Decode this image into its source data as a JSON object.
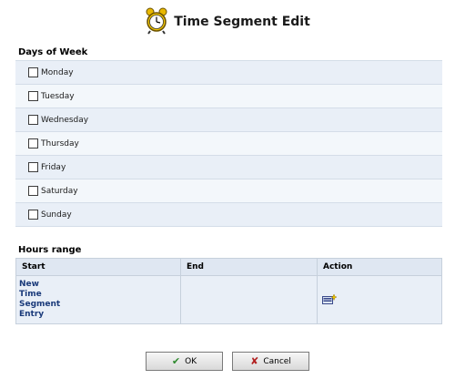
{
  "header": {
    "title": "Time Segment Edit",
    "icon": "alarm-clock-icon"
  },
  "days": {
    "title": "Days of Week",
    "items": [
      {
        "label": "Monday",
        "checked": false
      },
      {
        "label": "Tuesday",
        "checked": false
      },
      {
        "label": "Wednesday",
        "checked": false
      },
      {
        "label": "Thursday",
        "checked": false
      },
      {
        "label": "Friday",
        "checked": false
      },
      {
        "label": "Saturday",
        "checked": false
      },
      {
        "label": "Sunday",
        "checked": false
      }
    ]
  },
  "hours": {
    "title": "Hours range",
    "columns": [
      "Start",
      "End",
      "Action"
    ],
    "new_entry": "New Time Segment Entry",
    "new_entry_icon": "new-entry-icon"
  },
  "buttons": {
    "ok": "OK",
    "cancel": "Cancel"
  },
  "colors": {
    "row_alt_1": "#e9eff7",
    "row_alt_2": "#f3f7fb",
    "header_bg": "#dfe7f2",
    "link": "#1a3a7a"
  }
}
